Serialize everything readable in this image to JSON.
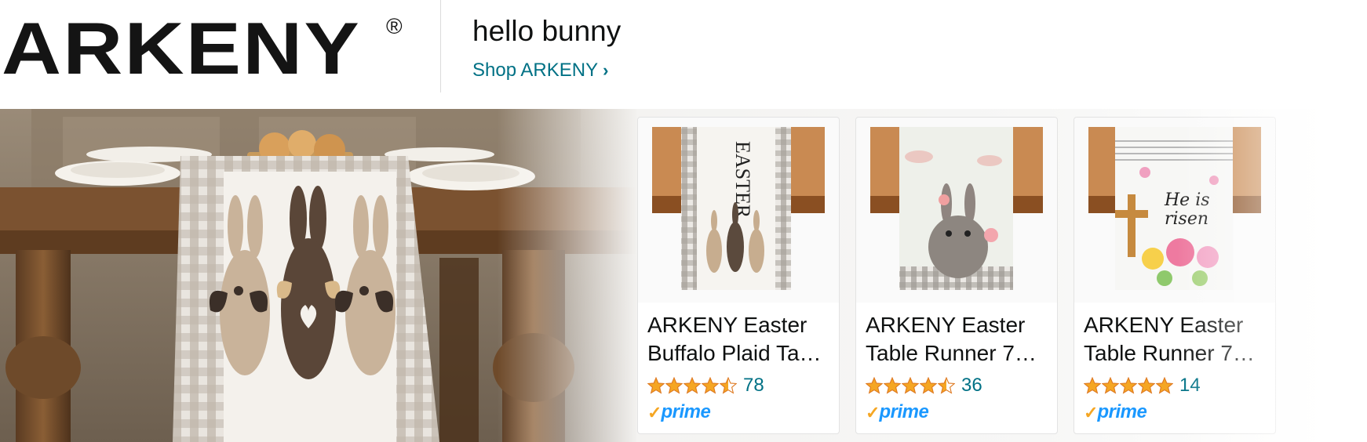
{
  "brand": {
    "logo_text": "ARKENY",
    "registered_mark": "®"
  },
  "header": {
    "headline": "hello bunny",
    "shop_link": "Shop ARKENY",
    "shop_link_chevron": "›"
  },
  "colors": {
    "link": "#007185",
    "star": "#f5a623",
    "prime_blue": "#1a98ff",
    "prime_check": "#f5a623"
  },
  "products": [
    {
      "title_line1": "ARKENY Easter",
      "title_line2": "Buffalo Plaid Ta…",
      "rating_stars": 4.5,
      "review_count": "78",
      "prime": "prime"
    },
    {
      "title_line1": "ARKENY Easter",
      "title_line2": "Table Runner 7…",
      "rating_stars": 4.5,
      "review_count": "36",
      "prime": "prime"
    },
    {
      "title_line1": "ARKENY Easter",
      "title_line2": "Table Runner 7…",
      "rating_stars": 5,
      "review_count": "14",
      "prime": "prime"
    }
  ],
  "product_image_text": {
    "p1_runner": "EASTER",
    "p3_runner_line1": "He is",
    "p3_runner_line2": "risen"
  }
}
